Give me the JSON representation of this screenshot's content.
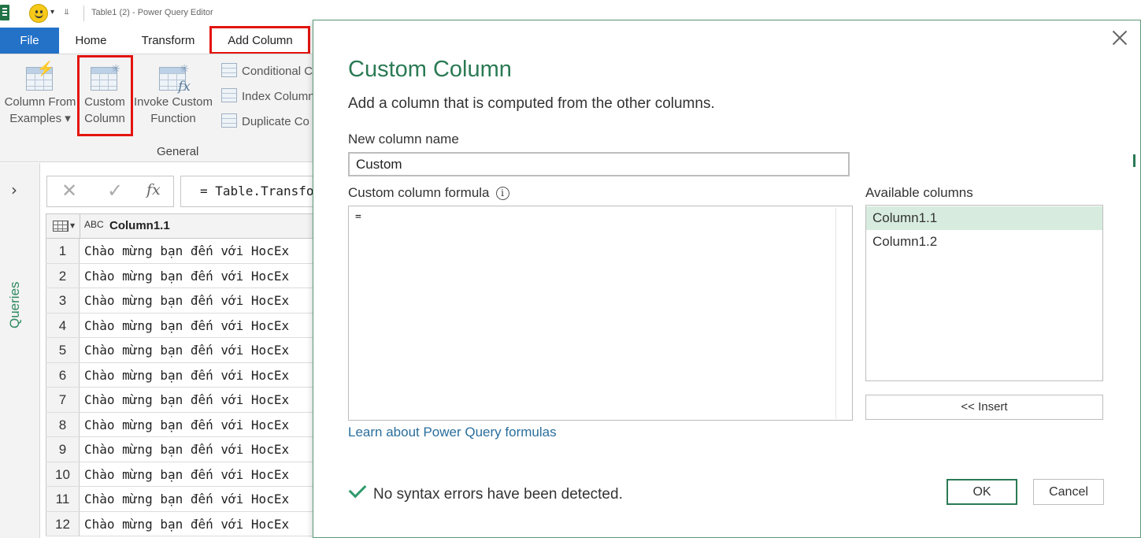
{
  "titlebar": {
    "title": "Table1 (2) - Power Query Editor",
    "smiley_icon": "smiley-icon",
    "customize_arrow": "▾"
  },
  "ribbon_tabs": [
    "File",
    "Home",
    "Transform",
    "Add Column"
  ],
  "active_tab": "Add Column",
  "highlight_color": "#e3140f",
  "ribbon": {
    "column_from_examples": {
      "line1": "Column From",
      "line2": "Examples ▾"
    },
    "custom_column": {
      "line1": "Custom",
      "line2": "Column"
    },
    "invoke_custom_function": {
      "line1": "Invoke Custom",
      "line2": "Function"
    },
    "conditional": "Conditional C",
    "index_column": "Index Column",
    "duplicate": "Duplicate Co",
    "group_label": "General"
  },
  "queries_pane": {
    "label": "Queries",
    "collapse_icon": "›"
  },
  "formula_bar": {
    "cancel": "✕",
    "confirm": "✓",
    "fx": "fx",
    "formula": "= Table.Transfo"
  },
  "grid": {
    "column_type": "ABC",
    "column_header": "Column1.1",
    "rows": [
      {
        "num": "1",
        "value": "Chào mừng bạn đến với HocEx"
      },
      {
        "num": "2",
        "value": "Chào mừng bạn đến với HocEx"
      },
      {
        "num": "3",
        "value": "Chào mừng bạn đến với HocEx"
      },
      {
        "num": "4",
        "value": "Chào mừng bạn đến với HocEx"
      },
      {
        "num": "5",
        "value": "Chào mừng bạn đến với HocEx"
      },
      {
        "num": "6",
        "value": "Chào mừng bạn đến với HocEx"
      },
      {
        "num": "7",
        "value": "Chào mừng bạn đến với HocEx"
      },
      {
        "num": "8",
        "value": "Chào mừng bạn đến với HocEx"
      },
      {
        "num": "9",
        "value": "Chào mừng bạn đến với HocEx"
      },
      {
        "num": "10",
        "value": "Chào mừng bạn đến với HocEx"
      },
      {
        "num": "11",
        "value": "Chào mừng bạn đến với HocEx"
      },
      {
        "num": "12",
        "value": "Chào mừng bạn đến với HocEx"
      }
    ]
  },
  "dialog": {
    "title": "Custom Column",
    "subtitle": "Add a column that is computed from the other columns.",
    "name_label": "New column name",
    "name_value": "Custom",
    "formula_label": "Custom column formula",
    "info_icon": "i",
    "formula_value": "=",
    "learn_link": "Learn about Power Query formulas",
    "available_label": "Available columns",
    "available_columns": [
      "Column1.1",
      "Column1.2"
    ],
    "selected_column": "Column1.1",
    "insert_button": "<< Insert",
    "status": "No syntax errors have been detected.",
    "ok_button": "OK",
    "cancel_button": "Cancel",
    "accent_color": "#2a7a54"
  }
}
